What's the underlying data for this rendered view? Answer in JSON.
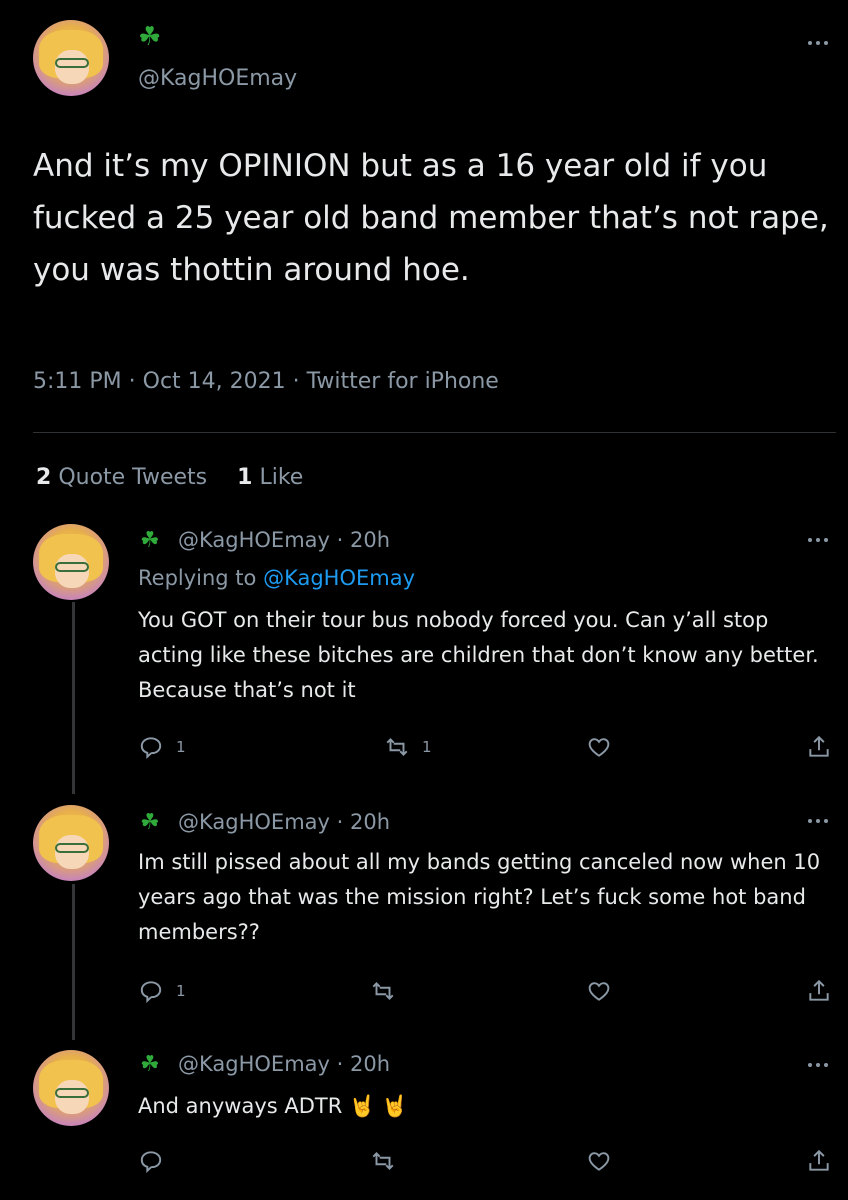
{
  "main_tweet": {
    "emoji": "☘",
    "handle": "@KagHOEmay",
    "text": "And it’s my OPINION but as a 16 year old if you fucked a 25 year old band member that’s not rape, you was thottin around hoe.",
    "meta": "5:11 PM · Oct 14, 2021 · Twitter for iPhone",
    "quote_count": "2",
    "quote_label": "Quote Tweets",
    "like_count": "1",
    "like_label": "Like"
  },
  "replies": [
    {
      "emoji": "☘",
      "handle_time": "@KagHOEmay · 20h",
      "replying_prefix": "Replying to ",
      "replying_to": "@KagHOEmay",
      "text": "You GOT on their tour bus nobody forced you. Can y’all stop acting like these bitches are children that don’t know any better. Because that’s not it",
      "reply_count": "1",
      "retweet_count": "1"
    },
    {
      "emoji": "☘",
      "handle_time": "@KagHOEmay · 20h",
      "text": "Im still pissed about all my bands getting canceled now when 10 years ago that was the mission right? Let’s fuck some hot band members??",
      "reply_count": "1",
      "retweet_count": ""
    },
    {
      "emoji": "☘",
      "handle_time": "@KagHOEmay · 20h",
      "text": "And anyways ADTR",
      "trailing_emoji": "🤘 🤘",
      "reply_count": "",
      "retweet_count": ""
    }
  ],
  "icons": [
    "clover-icon",
    "more-icon",
    "reply-icon",
    "retweet-icon",
    "like-icon",
    "share-icon"
  ],
  "colors": {
    "background": "#000000",
    "text": "#e7e9ea",
    "muted": "#8b98a5",
    "link": "#1d9bf0",
    "clover": "#2faa3b"
  }
}
